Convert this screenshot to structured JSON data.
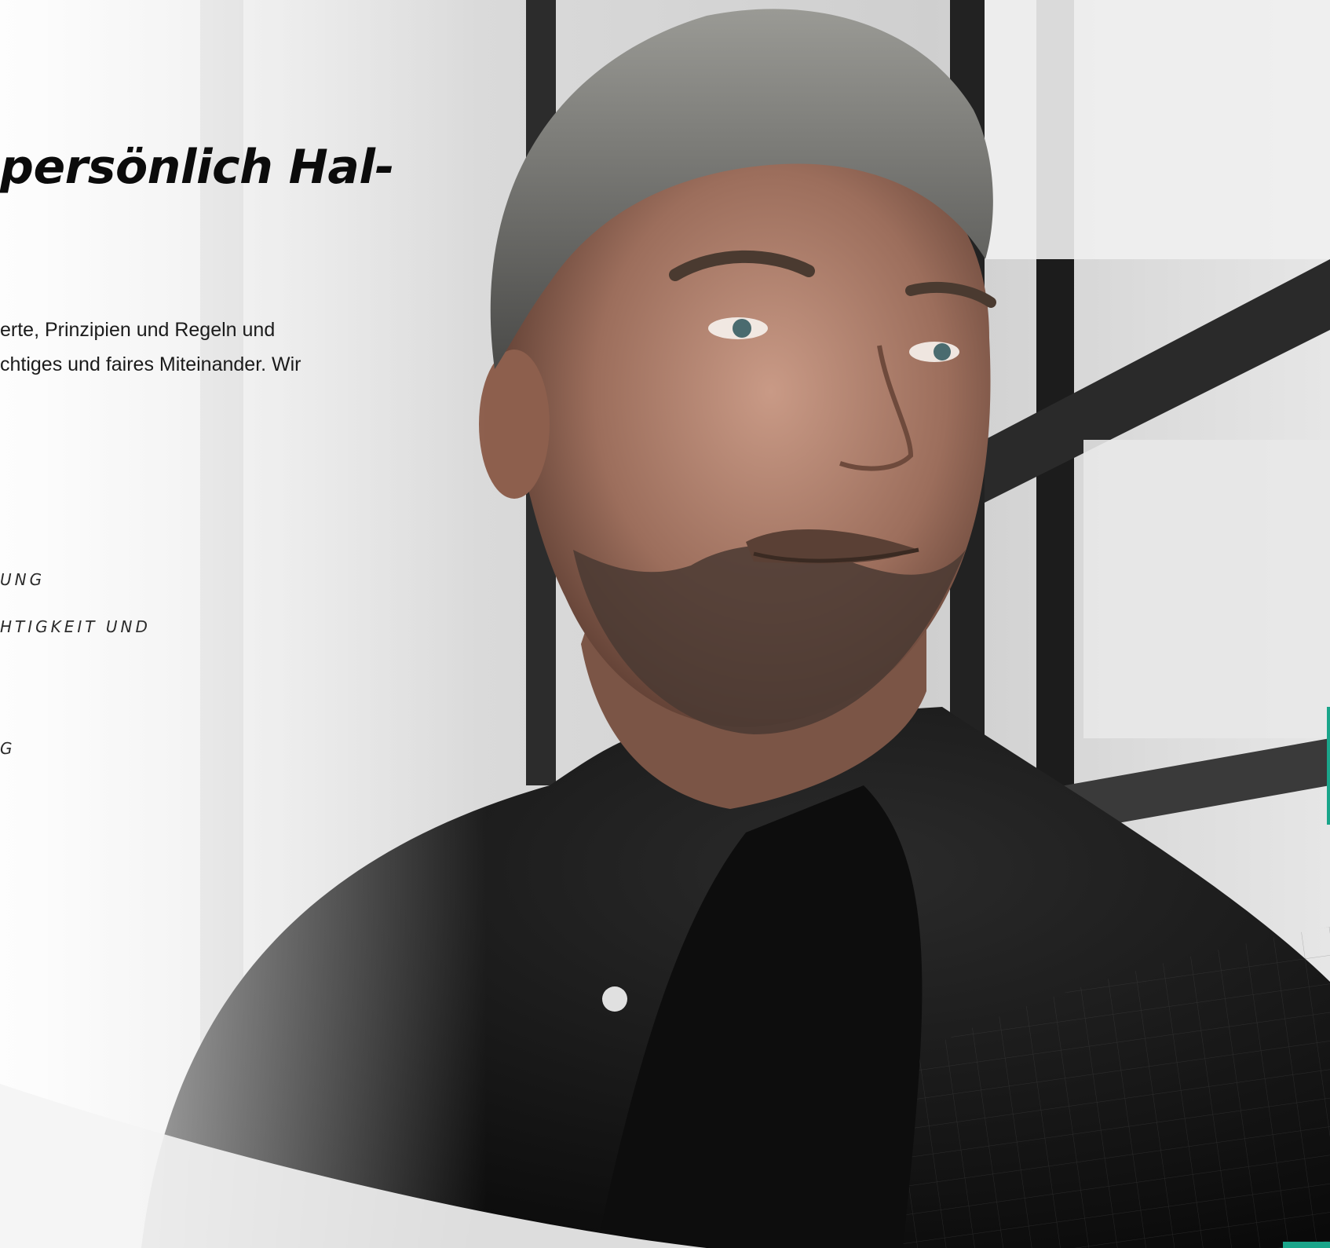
{
  "heading": "persönlich Hal-",
  "intro_lines": [
    "erte, Prinzipien und Regeln und",
    "chtiges und faires Miteinander. Wir"
  ],
  "list_items": [
    "UNG",
    "HTIGKEIT UND",
    "G"
  ],
  "colors": {
    "accent": "#1aa58a",
    "text": "#111111"
  }
}
